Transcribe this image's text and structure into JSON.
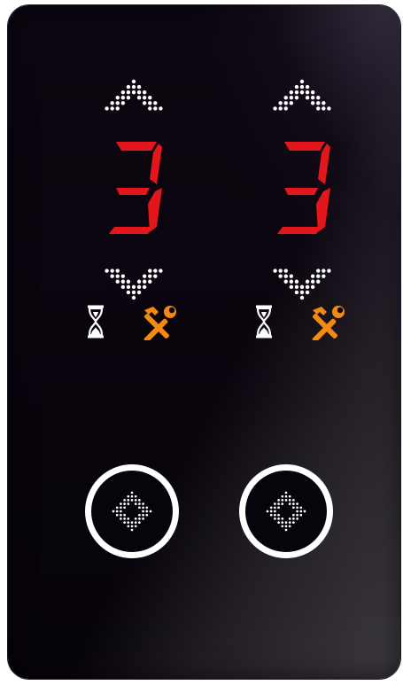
{
  "panel": {
    "type": "elevator-hall-indicator",
    "colors": {
      "background": "#07030a",
      "digit": "#e3161b",
      "arrow_dots": "#ffffff",
      "hourglass": "#ffffff",
      "tools": "#f28a12",
      "button_ring": "#ffffff"
    }
  },
  "indicators": [
    {
      "floor": "3",
      "up_arrow_icon": "dot-matrix-up-arrow-icon",
      "down_arrow_icon": "dot-matrix-down-arrow-icon",
      "busy_icon": "hourglass-icon",
      "maintenance_icon": "hammer-wrench-icon"
    },
    {
      "floor": "3",
      "up_arrow_icon": "dot-matrix-up-arrow-icon",
      "down_arrow_icon": "dot-matrix-down-arrow-icon",
      "busy_icon": "hourglass-icon",
      "maintenance_icon": "hammer-wrench-icon"
    }
  ],
  "call_buttons": [
    {
      "icon": "dot-matrix-diamond-icon"
    },
    {
      "icon": "dot-matrix-diamond-icon"
    }
  ]
}
